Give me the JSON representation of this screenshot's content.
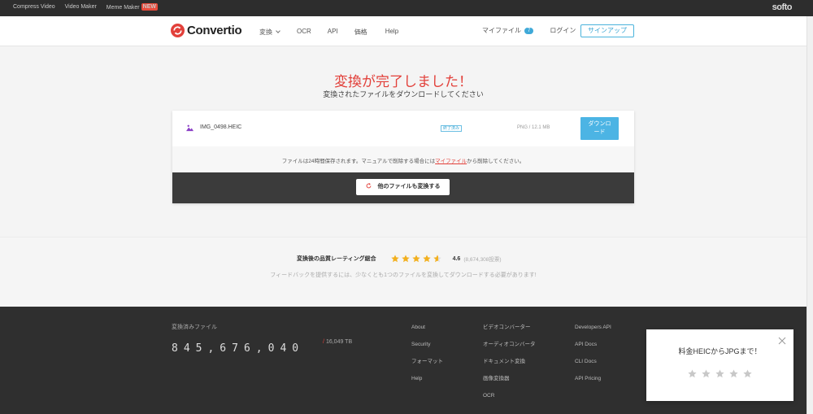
{
  "topbar": {
    "links": [
      "Compress Video",
      "Video Maker",
      "Meme Maker"
    ],
    "new_badge": "NEW",
    "brand": "softo"
  },
  "header": {
    "logo": "Convertio",
    "nav": [
      "変換",
      "OCR",
      "API",
      "価格",
      "Help"
    ],
    "my_files": "マイファイル",
    "my_files_count": "7",
    "login": "ログイン",
    "signup": "サインアップ"
  },
  "result": {
    "title": "変換が完了しました！",
    "subtitle": "変換されたファイルをダウンロードしてください"
  },
  "file": {
    "name": "IMG_0498.HEIC",
    "status": "終了済み",
    "info": "PNG / 12.1 MB",
    "download_line1": "ダウンロ",
    "download_line2": "ード"
  },
  "notice": {
    "before": "ファイルは24時間保存されます。マニュアルで削除する場合には",
    "link": "マイファイル",
    "after": "から削除してください。"
  },
  "convert_other": "他のファイルも変換する",
  "rating": {
    "label": "変換後の品質レーティング総合",
    "score": "4.6",
    "votes": "(8,674,308投票)",
    "value": 4.6,
    "max": 5,
    "feedback": "フィードバックを提供するには、少なくとも1つのファイルを変換してダウンロードする必要があります!"
  },
  "footer": {
    "converted_label": "変換済みファイル",
    "converted_count": "845,676,040",
    "tb": "16,049 TB",
    "col1": [
      "About",
      "Security",
      "フォーマット",
      "Help"
    ],
    "col2": [
      "ビデオコンバーター",
      "オーディオコンバータ",
      "ドキュメント変換",
      "画像変換器",
      "OCR"
    ],
    "col3": [
      "Developers API",
      "API Docs",
      "CLI Docs",
      "API Pricing"
    ]
  },
  "popup": {
    "title": "料金HEICからJPGまで！",
    "star_count": 5
  },
  "colors": {
    "accent_red": "#e2403a",
    "accent_blue": "#4cb4e4",
    "star_gold": "#f2b01e"
  }
}
